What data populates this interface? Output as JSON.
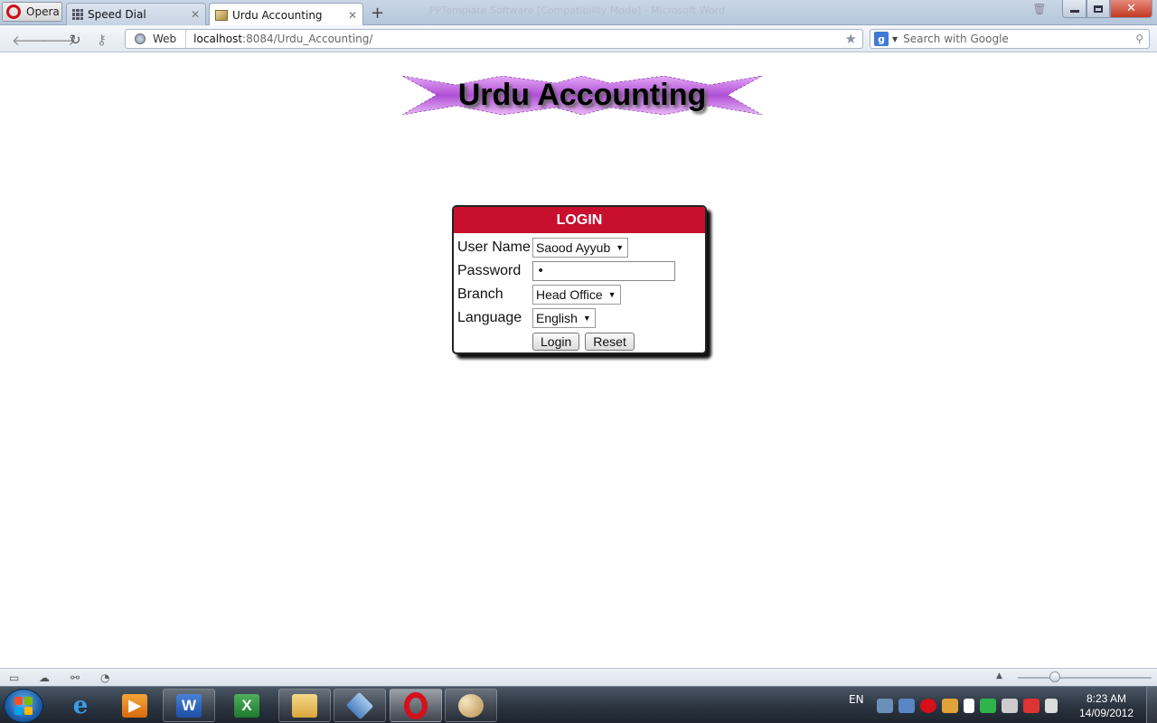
{
  "browser": {
    "menu_label": "Opera",
    "window_title": "PPTemplate Software [Compatibility Mode] - Microsoft Word",
    "tabs": [
      {
        "label": "Speed Dial",
        "icon": "speed-dial-grid-icon"
      },
      {
        "label": "Urdu Accounting",
        "icon": "site-favicon"
      }
    ],
    "address": {
      "web_label": "Web",
      "host": "localhost",
      "path": ":8084/Urdu_Accounting/"
    },
    "search": {
      "placeholder": "Search with Google"
    }
  },
  "page": {
    "banner_title": "Urdu Accounting",
    "login": {
      "header": "LOGIN",
      "fields": {
        "username": {
          "label": "User Name",
          "value": "Saood Ayyub"
        },
        "password": {
          "label": "Password",
          "value": "•"
        },
        "branch": {
          "label": "Branch",
          "value": "Head Office"
        },
        "language": {
          "label": "Language",
          "value": "English"
        }
      },
      "buttons": {
        "login": "Login",
        "reset": "Reset"
      }
    }
  },
  "taskbar": {
    "lang": "EN",
    "time": "8:23 AM",
    "date": "14/09/2012",
    "apps": [
      "internet-explorer",
      "media-player",
      "word",
      "excel",
      "file-explorer",
      "virtualbox",
      "opera",
      "paint"
    ]
  },
  "colors": {
    "login_header": "#c8102e",
    "banner_purple": "#b04fd6"
  }
}
